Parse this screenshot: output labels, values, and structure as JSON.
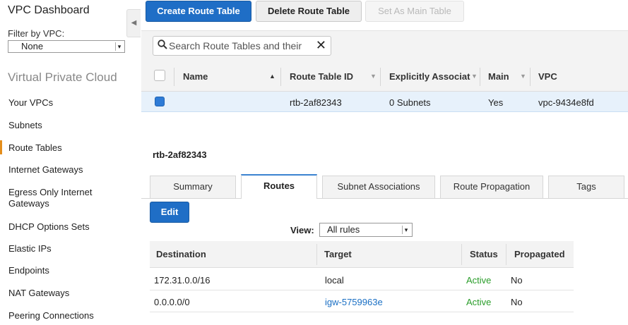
{
  "sidebar": {
    "title": "VPC Dashboard",
    "filter_label": "Filter by VPC:",
    "filter_value": "None",
    "section_title": "Virtual Private Cloud",
    "items": [
      {
        "label": "Your VPCs"
      },
      {
        "label": "Subnets"
      },
      {
        "label": "Route Tables"
      },
      {
        "label": "Internet Gateways"
      },
      {
        "label": "Egress Only Internet Gateways"
      },
      {
        "label": "DHCP Options Sets"
      },
      {
        "label": "Elastic IPs"
      },
      {
        "label": "Endpoints"
      },
      {
        "label": "NAT Gateways"
      },
      {
        "label": "Peering Connections"
      }
    ],
    "active_item": "Route Tables",
    "accent_color": "#e48e1b"
  },
  "toolbar": {
    "create_label": "Create Route Table",
    "delete_label": "Delete Route Table",
    "set_main_label": "Set As Main Table"
  },
  "search": {
    "placeholder": "Search Route Tables and their"
  },
  "table": {
    "columns": [
      "Name",
      "Route Table ID",
      "Explicitly Associat",
      "Main",
      "VPC"
    ],
    "rows": [
      {
        "name": "",
        "route_table_id": "rtb-2af82343",
        "explicitly_associated": "0 Subnets",
        "main": "Yes",
        "vpc": "vpc-9434e8fd",
        "selected": true
      }
    ]
  },
  "detail": {
    "title": "rtb-2af82343",
    "tabs": [
      {
        "label": "Summary"
      },
      {
        "label": "Routes"
      },
      {
        "label": "Subnet Associations"
      },
      {
        "label": "Route Propagation"
      },
      {
        "label": "Tags"
      }
    ],
    "active_tab": "Routes",
    "edit_label": "Edit",
    "view_label": "View:",
    "view_value": "All rules",
    "routes_columns": [
      "Destination",
      "Target",
      "Status",
      "Propagated"
    ],
    "routes": [
      {
        "destination": "172.31.0.0/16",
        "target": "local",
        "status": "Active",
        "propagated": "No"
      },
      {
        "destination": "0.0.0.0/0",
        "target": "igw-5759963e",
        "status": "Active",
        "propagated": "No"
      }
    ]
  },
  "colors": {
    "primary": "#1f6ec6",
    "active_status": "#2a9d2a",
    "link": "#1a6fc4"
  }
}
